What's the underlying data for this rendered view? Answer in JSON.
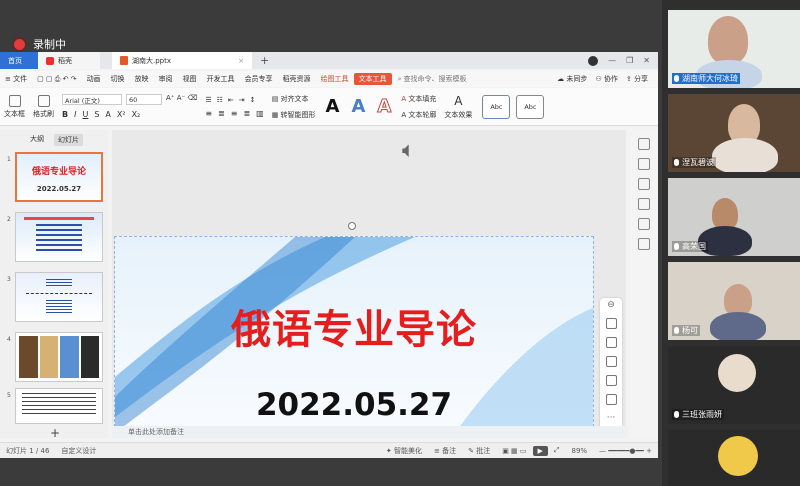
{
  "recording": {
    "label": "录制中"
  },
  "app": {
    "tabs": {
      "home": "首页",
      "wps": "稻壳",
      "doc": "湖南大.pptx"
    },
    "menu": {
      "file": "文件",
      "items": [
        "动画",
        "切换",
        "放映",
        "审阅",
        "视图",
        "开发工具",
        "会员专享",
        "稻壳资源",
        "绘图工具",
        "文本工具"
      ],
      "search": "查找命令、搜索模板",
      "sync": "未同步",
      "collab": "协作",
      "share": "分享"
    },
    "ribbon": {
      "textbox": "文本框",
      "format_painter": "格式刷",
      "font": "Arial (正文)",
      "size": "60",
      "textdir": "对齐文本",
      "shape_convert": "转智能图形",
      "text_fill": "文本填充",
      "text_outline": "文本轮廓",
      "text_effect": "文本效果",
      "abc1": "Abc",
      "abc2": "Abc",
      "bigA": "A"
    },
    "panel_tabs": {
      "outline": "大纲",
      "slides": "幻灯片"
    },
    "thumbs": [
      {
        "num": "1",
        "title": "俄语专业导论",
        "date": "2022.05.27"
      },
      {
        "num": "2"
      },
      {
        "num": "3"
      },
      {
        "num": "4"
      },
      {
        "num": "5"
      }
    ],
    "slide": {
      "title": "俄语专业导论",
      "date": "2022.05.27"
    },
    "notes": "单击此处添加备注",
    "status": {
      "slide_count": "幻灯片 1 / 46",
      "theme": "自定义设计",
      "beautify": "智能美化",
      "notes_btn": "备注",
      "comment": "批注",
      "zoom": "89%"
    }
  },
  "participants": [
    {
      "name": "湖南师大何冰琦"
    },
    {
      "name": "涅瓦碧波"
    },
    {
      "name": "高荣国"
    },
    {
      "name": "杨可"
    },
    {
      "name": "三班张雨妍"
    }
  ]
}
